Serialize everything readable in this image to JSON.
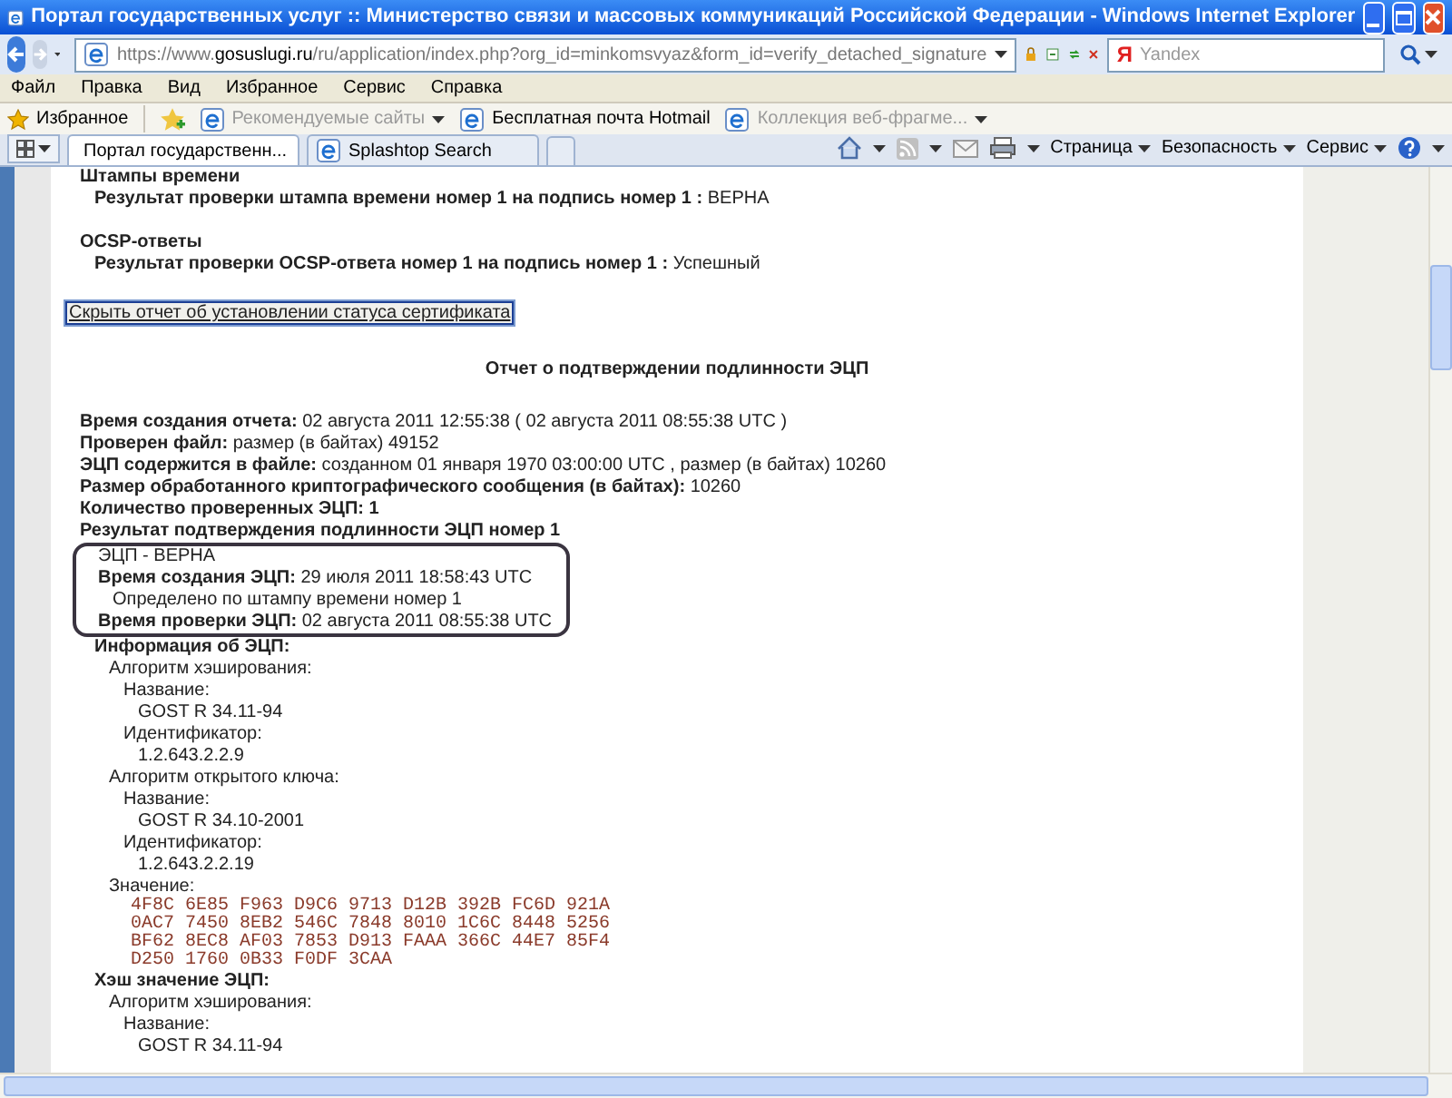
{
  "window": {
    "title": "Портал государственных услуг :: Министерство связи и массовых коммуникаций Российской Федерации - Windows Internet Explorer"
  },
  "address_bar": {
    "url_prefix": "https://www.",
    "url_domain": "gosuslugi.ru",
    "url_path": "/ru/application/index.php?org_id=minkomsvyaz&form_id=verify_detached_signature"
  },
  "search": {
    "engine_mark": "Я",
    "placeholder": "Yandex"
  },
  "menu": [
    "Файл",
    "Правка",
    "Вид",
    "Избранное",
    "Сервис",
    "Справка"
  ],
  "favorites_bar": {
    "label": "Избранное",
    "items": [
      {
        "label": "Рекомендуемые сайты",
        "disabled": true,
        "dropdown": true
      },
      {
        "label": "Бесплатная почта Hotmail",
        "disabled": false,
        "dropdown": false
      },
      {
        "label": "Коллекция веб-фрагме...",
        "disabled": true,
        "dropdown": true
      }
    ]
  },
  "tabs": [
    {
      "label": "Портал государственн...",
      "selected": true
    },
    {
      "label": "Splashtop Search",
      "selected": false
    }
  ],
  "command_bar": [
    "Страница",
    "Безопасность",
    "Сервис"
  ],
  "page": {
    "sections": [
      {
        "kind": "heading",
        "text": "Штампы времени",
        "children": [
          {
            "kind": "field",
            "label": "Результат проверки штампа времени номер 1 на подпись номер 1 :",
            "value": "ВЕРНА"
          }
        ]
      },
      {
        "kind": "heading",
        "text": "OCSP-ответы",
        "children": [
          {
            "kind": "field",
            "label": "Результат проверки OCSP-ответа номер 1 на подпись номер 1 :",
            "value": "Успешный"
          }
        ]
      }
    ],
    "toggle_button": "Скрыть отчет об установлении статуса сертификата",
    "report_title": "Отчет о подтверждении подлинности ЭЦП",
    "report": [
      {
        "kind": "field",
        "label": "Время создания отчета:",
        "value": "02 августа 2011 12:55:38 ( 02 августа 2011 08:55:38 UTC )"
      },
      {
        "kind": "field",
        "label": "Проверен файл:",
        "value": "размер (в байтах) 49152"
      },
      {
        "kind": "field",
        "label": "ЭЦП содержится в файле:",
        "value": "созданном 01 января 1970 03:00:00 UTC , размер (в байтах) 10260"
      },
      {
        "kind": "field",
        "label": "Размер обработанного криптографического сообщения (в байтах):",
        "value": "10260"
      },
      {
        "kind": "heading",
        "text": "Количество проверенных ЭЦП: 1"
      },
      {
        "kind": "heading",
        "text": "Результат подтверждения подлинности ЭЦП номер 1",
        "children": [
          {
            "kind": "circled",
            "children": [
              {
                "kind": "plain",
                "text": "ЭЦП - ВЕРНА"
              },
              {
                "kind": "field",
                "label": "Время создания ЭЦП:",
                "value": "29 июля 2011 18:58:43 UTC",
                "children": [
                  {
                    "kind": "plain",
                    "text": "Определено по штампу времени номер 1"
                  }
                ]
              },
              {
                "kind": "field",
                "label": "Время проверки ЭЦП:",
                "value": "02 августа 2011 08:55:38 UTC"
              }
            ]
          },
          {
            "kind": "heading",
            "text": "Информация об ЭЦП:",
            "children": [
              {
                "kind": "plain",
                "text": "Алгоритм хэширования:",
                "children": [
                  {
                    "kind": "plain",
                    "text": "Название:",
                    "children": [
                      {
                        "kind": "plain",
                        "text": "GOST R 34.11-94"
                      }
                    ]
                  },
                  {
                    "kind": "plain",
                    "text": "Идентификатор:",
                    "children": [
                      {
                        "kind": "plain",
                        "text": "1.2.643.2.2.9"
                      }
                    ]
                  }
                ]
              },
              {
                "kind": "plain",
                "text": "Алгоритм открытого ключа:",
                "children": [
                  {
                    "kind": "plain",
                    "text": "Название:",
                    "children": [
                      {
                        "kind": "plain",
                        "text": "GOST R 34.10-2001"
                      }
                    ]
                  },
                  {
                    "kind": "plain",
                    "text": "Идентификатор:",
                    "children": [
                      {
                        "kind": "plain",
                        "text": "1.2.643.2.2.19"
                      }
                    ]
                  }
                ]
              },
              {
                "kind": "plain",
                "text": "Значение:",
                "children": [
                  {
                    "kind": "hex",
                    "lines": [
                      "4F8C 6E85 F963 D9C6 9713 D12B 392B FC6D 921A",
                      "0AC7 7450 8EB2 546C 7848 8010 1C6C 8448 5256",
                      "BF62 8EC8 AF03 7853 D913 FAAA 366C 44E7 85F4",
                      "D250 1760 0B33 F0DF 3CAA"
                    ]
                  }
                ]
              }
            ]
          },
          {
            "kind": "heading",
            "text": "Хэш значение ЭЦП:",
            "children": [
              {
                "kind": "plain",
                "text": "Алгоритм хэширования:",
                "children": [
                  {
                    "kind": "plain",
                    "text": "Название:",
                    "children": [
                      {
                        "kind": "plain",
                        "text": "GOST R 34.11-94"
                      }
                    ]
                  }
                ]
              }
            ]
          }
        ]
      }
    ]
  }
}
